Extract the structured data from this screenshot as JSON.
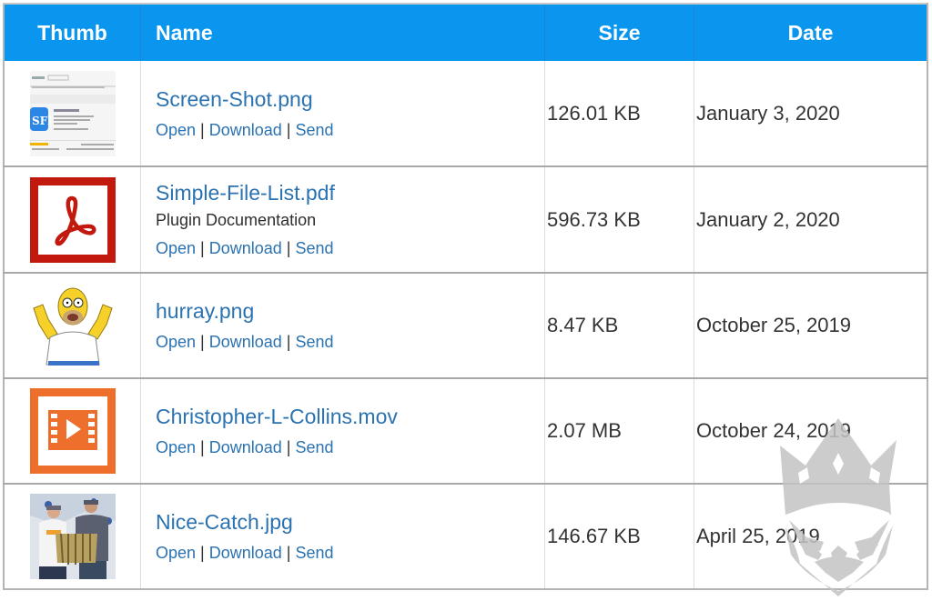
{
  "table": {
    "headers": {
      "thumb": "Thumb",
      "name": "Name",
      "size": "Size",
      "date": "Date"
    },
    "colors": {
      "header_bg": "#0a95ee",
      "link": "#2b72b0",
      "pdf_icon": "#c2190f",
      "video_icon": "#ee6f2b"
    },
    "rows": [
      {
        "thumb_icon": "screenshot-thumbnail",
        "name": "Screen-Shot.png",
        "description": "",
        "actions": {
          "open": "Open",
          "download": "Download",
          "send": "Send",
          "separator": "|"
        },
        "size": "126.01 KB",
        "date": "January 3, 2020"
      },
      {
        "thumb_icon": "pdf-icon",
        "name": "Simple-File-List.pdf",
        "description": "Plugin Documentation",
        "actions": {
          "open": "Open",
          "download": "Download",
          "send": "Send",
          "separator": "|"
        },
        "size": "596.73 KB",
        "date": "January 2, 2020"
      },
      {
        "thumb_icon": "homer-thumbnail",
        "name": "hurray.png",
        "description": "",
        "actions": {
          "open": "Open",
          "download": "Download",
          "send": "Send",
          "separator": "|"
        },
        "size": "8.47 KB",
        "date": "October 25, 2019"
      },
      {
        "thumb_icon": "video-icon",
        "name": "Christopher-L-Collins.mov",
        "description": "",
        "actions": {
          "open": "Open",
          "download": "Download",
          "send": "Send",
          "separator": "|"
        },
        "size": "2.07 MB",
        "date": "October 24, 2019"
      },
      {
        "thumb_icon": "photo-thumbnail",
        "name": "Nice-Catch.jpg",
        "description": "",
        "actions": {
          "open": "Open",
          "download": "Download",
          "send": "Send",
          "separator": "|"
        },
        "size": "146.67 KB",
        "date": "April 25, 2019"
      }
    ]
  },
  "watermark": {
    "icon": "crowned-mask-watermark-icon"
  }
}
